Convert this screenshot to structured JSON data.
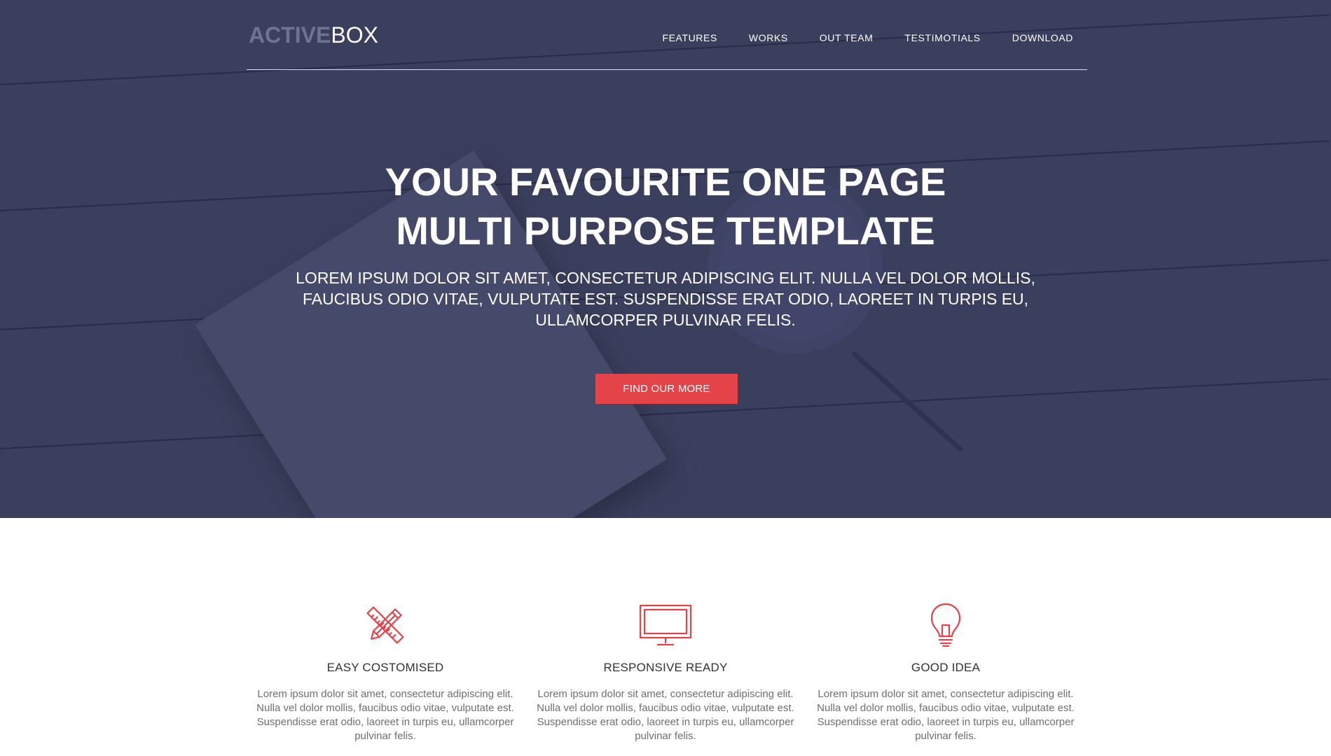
{
  "brand": {
    "logo_part1": "ACTIVE",
    "logo_part2": "BOX"
  },
  "nav": {
    "items": [
      {
        "label": "FEATURES"
      },
      {
        "label": "WORKS"
      },
      {
        "label": "OUT TEAM"
      },
      {
        "label": "TESTIMOTIALS"
      },
      {
        "label": "DOWNLOAD"
      }
    ]
  },
  "hero": {
    "headline_line1": "YOUR FAVOURITE ONE PAGE",
    "headline_line2": "MULTI PURPOSE TEMPLATE",
    "subtext_line1": "LOREM IPSUM DOLOR SIT AMET, CONSECTETUR ADIPISCING ELIT. NULLA VEL DOLOR MOLLIS,",
    "subtext_line2": "FAUCIBUS ODIO VITAE, VULPUTATE EST. SUSPENDISSE ERAT ODIO, LAOREET IN TURPIS EU,",
    "subtext_line3": "ULLAMCORPER PULVINAR FELIS.",
    "cta_label": "FIND OUR MORE"
  },
  "features": [
    {
      "icon": "pencil-ruler-icon",
      "title": "EASY COSTOMISED",
      "text": "Lorem ipsum dolor sit amet, consectetur adipiscing elit. Nulla vel dolor mollis, faucibus odio vitae, vulputate est. Suspendisse erat odio, laoreet in turpis eu, ullamcorper pulvinar felis."
    },
    {
      "icon": "monitor-icon",
      "title": "RESPONSIVE READY",
      "text": "Lorem ipsum dolor sit amet, consectetur adipiscing elit. Nulla vel dolor mollis, faucibus odio vitae, vulputate est. Suspendisse erat odio, laoreet in turpis eu, ullamcorper pulvinar felis."
    },
    {
      "icon": "lightbulb-icon",
      "title": "GOOD IDEA",
      "text": "Lorem ipsum dolor sit amet, consectetur adipiscing elit. Nulla vel dolor mollis, faucibus odio vitae, vulputate est. Suspendisse erat odio, laoreet in turpis eu, ullamcorper pulvinar felis."
    }
  ],
  "colors": {
    "hero_overlay": "#3b3f5e",
    "accent": "#e5434a",
    "logo_muted": "#70738f"
  }
}
